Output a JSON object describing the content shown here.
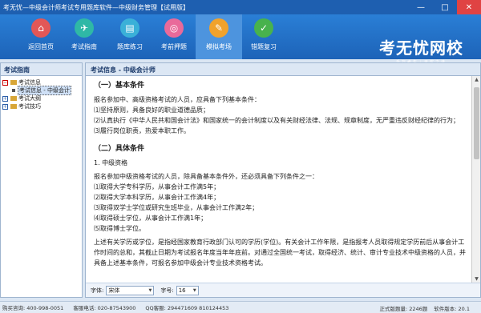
{
  "window": {
    "title": "考无忧—中级会计师考试专用题库软件—中级财务管理【试用版】",
    "controls": [
      "—",
      "□",
      "✕"
    ]
  },
  "toolbar": {
    "items": [
      {
        "label": "返回首页",
        "icon": "home-icon",
        "color": "#e25757"
      },
      {
        "label": "考试指南",
        "icon": "compass-icon",
        "color": "#2fb8a6"
      },
      {
        "label": "题库练习",
        "icon": "book-icon",
        "color": "#3ab0d8"
      },
      {
        "label": "考前押题",
        "icon": "target-icon",
        "color": "#e96a9a"
      },
      {
        "label": "模拟考场",
        "icon": "pencil-icon",
        "color": "#f0a22c"
      },
      {
        "label": "错题复习",
        "icon": "review-icon",
        "color": "#48b24d"
      }
    ],
    "active_index": 4,
    "brand_name": "考无忧网校",
    "brand_tag": "千万考生｜无忧之选"
  },
  "left": {
    "header": "考试指南",
    "tree": [
      {
        "label": "考试信息",
        "type": "folder",
        "expanded": true
      },
      {
        "label": "考试信息 - 中级会计",
        "type": "child",
        "selected": true
      },
      {
        "label": "考试大纲",
        "type": "folder",
        "expanded": false
      },
      {
        "label": "考试技巧",
        "type": "folder",
        "expanded": false
      }
    ]
  },
  "right": {
    "header": "考试信息 - 中级会计师",
    "lines": [
      {
        "kind": "sec",
        "text": "（一）基本条件"
      },
      {
        "kind": "para",
        "text": "报名参加中、高级资格考试的人员，应具备下列基本条件："
      },
      {
        "kind": "para",
        "text": "⑴坚持原则，具备良好的职业道德品质；"
      },
      {
        "kind": "para",
        "text": "⑵认真执行《中华人民共和国会计法》和国家统一的会计制度以及有关财经法律、法规、规章制度，无严重违反财经纪律的行为；"
      },
      {
        "kind": "para",
        "text": "⑶履行岗位职责，热爱本职工作。"
      },
      {
        "kind": "sec",
        "text": "（二）具体条件"
      },
      {
        "kind": "para",
        "text": "1. 中级资格"
      },
      {
        "kind": "para",
        "text": "报名参加中级资格考试的人员，除具备基本条件外，还必须具备下列条件之一："
      },
      {
        "kind": "para",
        "text": "⑴取得大学专科学历，从事会计工作满5年；"
      },
      {
        "kind": "para",
        "text": "⑵取得大学本科学历，从事会计工作满4年；"
      },
      {
        "kind": "para",
        "text": "⑶取得双学士学位或研究生班毕业，从事会计工作满2年；"
      },
      {
        "kind": "para",
        "text": "⑷取得硕士学位，从事会计工作满1年；"
      },
      {
        "kind": "para",
        "text": "⑸取得博士学位。"
      },
      {
        "kind": "para",
        "text": "上述有关学历或学位，是指经国家教育行政部门认可的学历(学位)。有关会计工作年限，是指报考人员取得规定学历前后从事会计工作时间的总和，其截止日期为考试报名年度当年年底前。对通过全国统一考试，取得经济、统计、审计专业技术中级资格的人员，并具备上述基本条件，可报名参加中级会计专业技术资格考试。"
      }
    ],
    "font_label": "字体:",
    "font_value": "宋体",
    "size_label": "字号:",
    "size_value": "16"
  },
  "status": {
    "phone": "购买咨询: 400-998-0051",
    "service": "客服电话: 020-87543900",
    "qq": "QQ客服: 294471609   810124453",
    "total": "正式版题量: 2246题",
    "version": "软件版本: 20.1"
  }
}
